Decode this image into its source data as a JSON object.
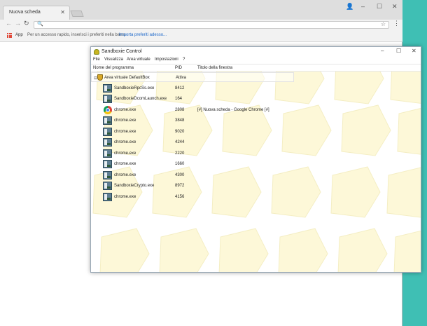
{
  "browser": {
    "tab_title": "Nuova scheda",
    "tab_close": "✕",
    "window_controls": {
      "user": "👤",
      "minimize": "–",
      "maximize": "☐",
      "close": "✕"
    },
    "nav": {
      "back": "←",
      "forward": "→",
      "reload": "↻"
    },
    "omnibox": {
      "value": "",
      "search_icon": "🔍",
      "star_icon": "☆"
    },
    "menu_icon": "⋮",
    "bookmarks": {
      "apps_label": "App",
      "hint": "Per un accesso rapido, inserisci i preferiti nella barra.",
      "import_link": "Importa preferiti adesso..."
    }
  },
  "sandboxie": {
    "title": "Sandboxie Control",
    "controls": {
      "minimize": "–",
      "maximize": "☐",
      "close": "✕"
    },
    "menu": [
      "File",
      "Visualizza",
      "Area virtuale",
      "Impostazioni",
      "?"
    ],
    "columns": [
      "Nome del programma",
      "PID",
      "Titolo della finestra"
    ],
    "box": {
      "name": "Area virtuale DefaultBox",
      "status": "Attiva"
    },
    "processes": [
      {
        "name": "SandboxieRpcSs.exe",
        "pid": "8412",
        "title": "",
        "icon": "program-icon"
      },
      {
        "name": "SandboxieDcomLaunch.exe",
        "pid": "164",
        "title": "",
        "icon": "program-icon"
      },
      {
        "name": "chrome.exe",
        "pid": "2808",
        "title": "[#] Nuova scheda - Google Chrome [#]",
        "icon": "chrome-icon"
      },
      {
        "name": "chrome.exe",
        "pid": "3848",
        "title": "",
        "icon": "program-icon"
      },
      {
        "name": "chrome.exe",
        "pid": "9020",
        "title": "",
        "icon": "program-icon"
      },
      {
        "name": "chrome.exe",
        "pid": "4244",
        "title": "",
        "icon": "program-icon"
      },
      {
        "name": "chrome.exe",
        "pid": "2220",
        "title": "",
        "icon": "program-icon"
      },
      {
        "name": "chrome.exe",
        "pid": "1660",
        "title": "",
        "icon": "program-icon"
      },
      {
        "name": "chrome.exe",
        "pid": "4300",
        "title": "",
        "icon": "program-icon"
      },
      {
        "name": "SandboxieCrypto.exe",
        "pid": "8972",
        "title": "",
        "icon": "program-icon"
      },
      {
        "name": "chrome.exe",
        "pid": "4156",
        "title": "",
        "icon": "program-icon"
      }
    ]
  },
  "colors": {
    "desktop": "#3fbfb4",
    "link": "#1a66c9",
    "sandbox_pattern": "#fdf8d8"
  }
}
